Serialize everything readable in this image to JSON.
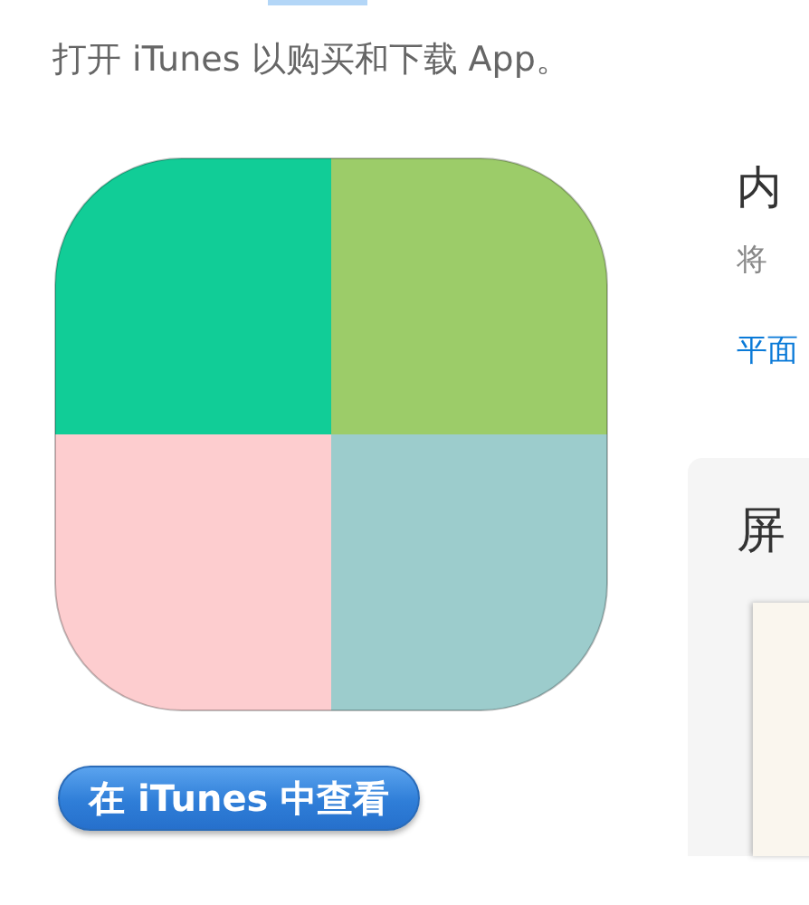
{
  "header": {
    "text": "打开 iTunes 以购买和下载 App。"
  },
  "app": {
    "button": "在 iTunes 中查看"
  },
  "info": {
    "title": "内",
    "description": "将",
    "link": "平面"
  },
  "screenshots": {
    "title": "屏"
  }
}
